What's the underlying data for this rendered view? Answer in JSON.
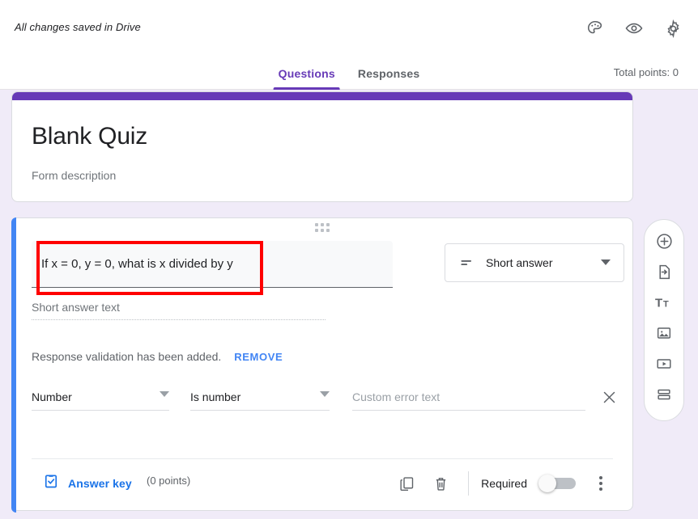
{
  "topbar": {
    "save_status": "All changes saved in Drive",
    "icons": [
      {
        "name": "palette-icon",
        "label": "Customize theme"
      },
      {
        "name": "eye-icon",
        "label": "Preview"
      },
      {
        "name": "gear-icon",
        "label": "Settings"
      }
    ]
  },
  "tabs": [
    {
      "label": "Questions",
      "active": true
    },
    {
      "label": "Responses",
      "active": false
    }
  ],
  "total_points": "Total points: 0",
  "header_card": {
    "title": "Blank Quiz",
    "description": "Form description",
    "stripe_color": "#673ab7"
  },
  "question": {
    "drag_handle": "drag-handle",
    "text": "If x = 0, y = 0, what is x divided by y",
    "type": {
      "label": "Short answer",
      "icon": "short-answer-icon",
      "arrow": "chevron-down-icon"
    },
    "answer_placeholder": "Short answer text",
    "validation": {
      "note": "Response validation has been added.",
      "remove_label": "REMOVE",
      "criteria_type": "Number",
      "criteria_condition": "Is number",
      "error_placeholder": "Custom error text",
      "close_icon": "close-icon"
    },
    "footer": {
      "answer_key_label": "Answer key",
      "answer_key_icon": "clipboard-check-icon",
      "points_label": "(0 points)",
      "duplicate_icon": "duplicate-icon",
      "delete_icon": "trash-icon",
      "required_label": "Required",
      "required_on": false,
      "more_icon": "more-vert-icon"
    },
    "accent_color": "#4285f4",
    "annotation_color": "#ff0000"
  },
  "side_toolbar": [
    {
      "name": "add-question-icon",
      "label": "Add question"
    },
    {
      "name": "import-questions-icon",
      "label": "Import questions"
    },
    {
      "name": "add-title-description-icon",
      "label": "Add title and description"
    },
    {
      "name": "add-image-icon",
      "label": "Add image"
    },
    {
      "name": "add-video-icon",
      "label": "Add video"
    },
    {
      "name": "add-section-icon",
      "label": "Add section"
    }
  ],
  "colors": {
    "page_background": "#f0ebf8",
    "accent_purple": "#673ab7",
    "accent_blue": "#4285f4",
    "link_blue": "#1a73e8"
  }
}
